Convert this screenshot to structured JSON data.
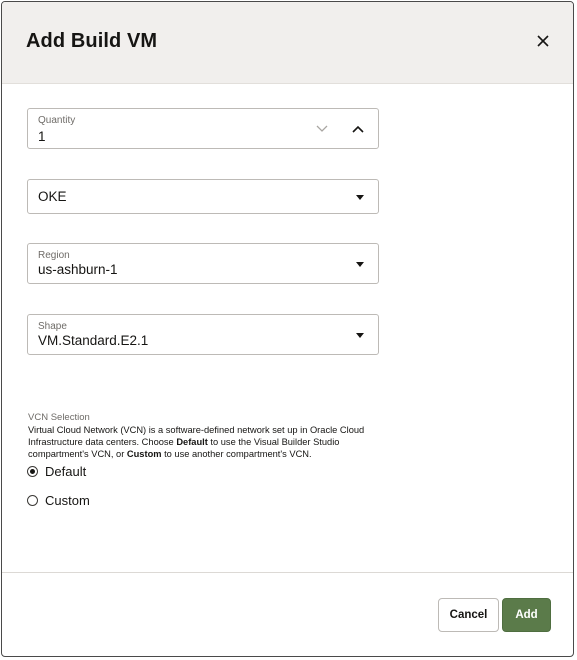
{
  "dialog": {
    "title": "Add Build VM",
    "close_icon": "close-icon"
  },
  "quantity": {
    "label": "Quantity",
    "value": "1",
    "decrement_icon": "chevron-down-icon",
    "increment_icon": "chevron-up-icon"
  },
  "image_select": {
    "value": "OKE"
  },
  "region": {
    "label": "Region",
    "value": "us-ashburn-1"
  },
  "shape": {
    "label": "Shape",
    "value": "VM.Standard.E2.1"
  },
  "vcn": {
    "label": "VCN Selection",
    "help_part1": "Virtual Cloud Network (VCN) is a software-defined network set up in Oracle Cloud Infrastructure data centers. Choose ",
    "help_bold1": "Default",
    "help_part2": " to use the Visual Builder Studio compartment's VCN, or ",
    "help_bold2": "Custom",
    "help_part3": " to use another compartment's VCN.",
    "options": [
      {
        "label": "Default",
        "checked": true
      },
      {
        "label": "Custom",
        "checked": false
      }
    ]
  },
  "footer": {
    "cancel_label": "Cancel",
    "add_label": "Add"
  },
  "colors": {
    "header_bg": "#f1efed",
    "primary_button": "#5b7b4a",
    "text": "#161513"
  }
}
